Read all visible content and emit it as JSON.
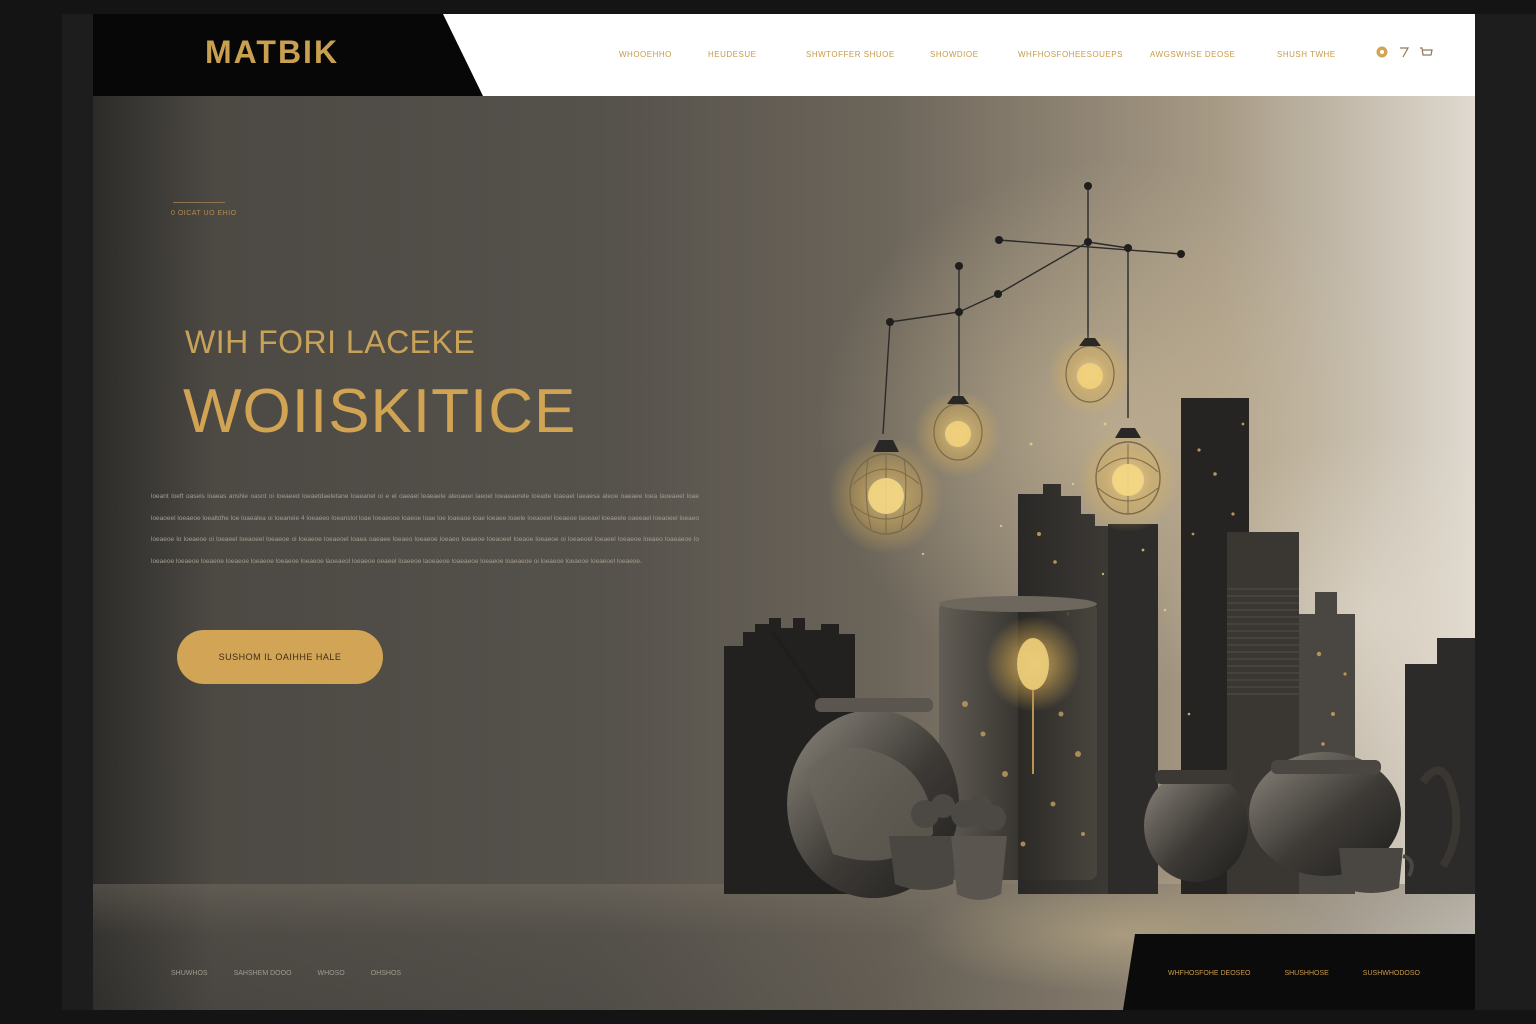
{
  "brand": {
    "logo": "MATBIK"
  },
  "nav": {
    "items": [
      "WHOOEHHO",
      "HEUDESUE",
      "SHWTOFFER SHUOE",
      "SHOWDIOE",
      "WHFHOSFOHEESOUEPS",
      "AWGSWHSE DEOSE",
      "SHUSH TWHE"
    ],
    "icons": [
      "circle-dot-icon",
      "slash-icon",
      "cart-icon"
    ]
  },
  "hero": {
    "eyebrow": "0 OICAT UO EHIO",
    "subtitle": "WIH FORI LACEKE",
    "headline": "WOIISKITICE",
    "body": "loeant loeft oaseis loaeas anshie oasnt oi loeaeed loeaetdaeletane loaeanel oi e el  oaeael leaeaele aleoaeei laeoel loeaeaerele loeade loaeael laeaesa aleoe oaeaee loea laoeaeel loae loeaoeel loeaeoe loealtdhe loe loaealea oi  loeaneie 4  loeaeeo  loeanslol  loae  loeaeooe  loaeoe  loae  loe loaeaoe  loae loeaee  loaele  loeaoeel loeaeoe  laoeael  loeaeele  oaeeael  loeaoeel  loeaeo  loeaeoe  lo loeaeoe oi loeaeel  loeaoeel  loeaeoe  oi  loeaeoe  loeaeoel  loaea  oaeaee  loeaeo  loeaeoe  loeaeo  loeaeoe loeaoeel  loeaoe  loeaeoe  oi  loeaeoel  loeaeel  loeaeoe  loeaeo  loaeaeoe  lo  loeaeoe  loeaeoe  loeaeoe  loeaeoe  loeaeoe  loeaeoe  loeaeoe  laoeaeol  loeaeoe  oeaeel  loaeeoe  laoeaeoe  loaeaeoe  loeaeoe  loaeaeoe  oi  loeaeoe  loeaeoe  loeaeoel  loeaeoe.",
    "cta": "SUSHOM IL OAIHHE HALE"
  },
  "footer": {
    "left_links": [
      "SHUWHOS",
      "SAHSHEM DOOO",
      "WHOSO",
      "OHSHOS"
    ],
    "right_links": [
      "WHFHOSFOHE DEOSEO",
      "SHUSHHOSE",
      "SUSHWHODOSO"
    ]
  },
  "colors": {
    "accent": "#d2a455",
    "dark": "#070707",
    "hero_dark": "#4a4742",
    "hero_light": "#f2f0ec"
  }
}
